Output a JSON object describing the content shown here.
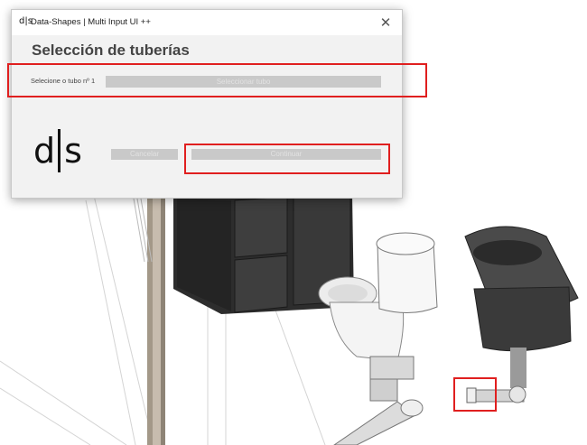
{
  "window": {
    "app_logo": "d|s",
    "title": "Data-Shapes | Multi Input UI ++",
    "close_glyph": "✕"
  },
  "dialog": {
    "heading": "Selección de tuberías",
    "pick_label": "Selecione o tubo nº 1",
    "pick_button_label": "Seleccionar tubo",
    "logo": {
      "left": "d",
      "right": "s"
    },
    "cancel_label": "Cancelar",
    "ok_label": "Continuar"
  },
  "colors": {
    "highlight": "#e01f1f",
    "button_bg": "#c9c9c9",
    "dialog_bg": "#f2f2f2"
  }
}
